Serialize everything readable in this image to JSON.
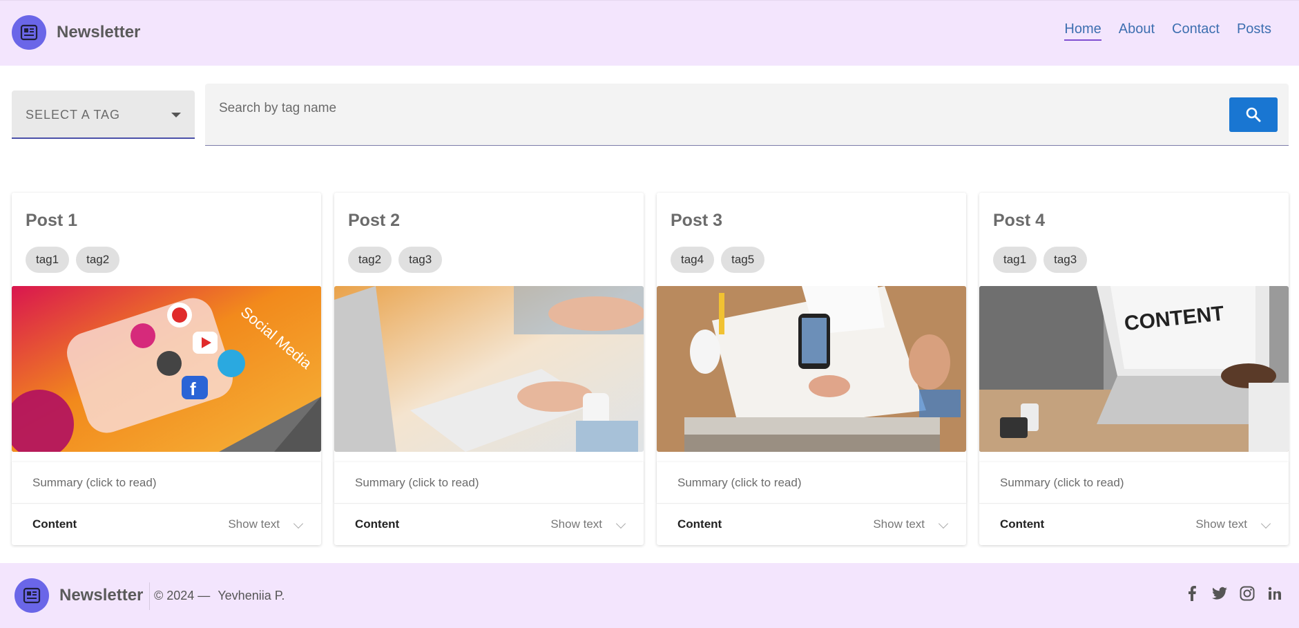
{
  "header": {
    "brand": "Newsletter",
    "brand_icon": "newspaper-icon",
    "nav": [
      {
        "label": "Home",
        "active": true
      },
      {
        "label": "About",
        "active": false
      },
      {
        "label": "Contact",
        "active": false
      },
      {
        "label": "Posts",
        "active": false
      }
    ]
  },
  "filters": {
    "tag_select_label": "SELECT A TAG",
    "search_placeholder": "Search by tag name",
    "search_button_icon": "search-icon"
  },
  "posts": [
    {
      "title": "Post 1",
      "tags": [
        "tag1",
        "tag2"
      ],
      "image": "social-media-phone",
      "summary": "Summary (click to read)",
      "content_label": "Content",
      "show_text": "Show text"
    },
    {
      "title": "Post 2",
      "tags": [
        "tag2",
        "tag3"
      ],
      "image": "desk-keyboard",
      "summary": "Summary (click to read)",
      "content_label": "Content",
      "show_text": "Show text"
    },
    {
      "title": "Post 3",
      "tags": [
        "tag4",
        "tag5"
      ],
      "image": "desk-sketching",
      "summary": "Summary (click to read)",
      "content_label": "Content",
      "show_text": "Show text"
    },
    {
      "title": "Post 4",
      "tags": [
        "tag1",
        "tag3"
      ],
      "image": "laptop-content",
      "summary": "Summary (click to read)",
      "content_label": "Content",
      "show_text": "Show text"
    }
  ],
  "footer": {
    "brand": "Newsletter",
    "copyright": "© 2024 — ",
    "author": "Yevheniia P.",
    "socials": [
      "facebook-icon",
      "twitter-icon",
      "instagram-icon",
      "linkedin-icon"
    ]
  },
  "colors": {
    "header_bg": "#f3e5fd",
    "logo_bg": "#6a66e8",
    "nav_link": "#3d6fb0",
    "nav_active_underline": "#7f4fd1",
    "search_button": "#1976d2"
  }
}
